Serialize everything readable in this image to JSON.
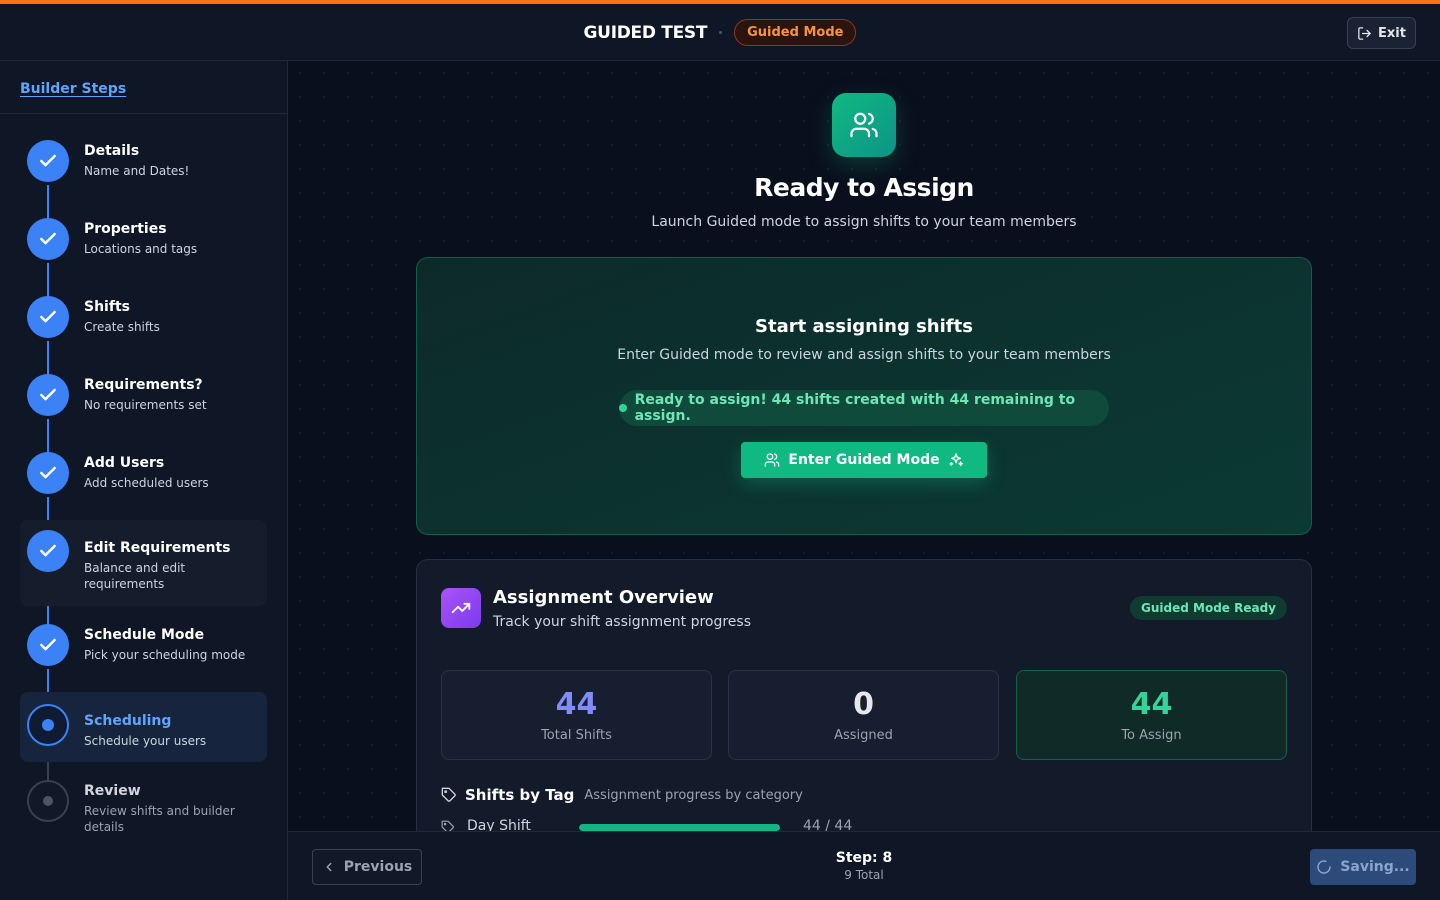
{
  "header": {
    "title": "GUIDED TEST",
    "mode_badge": "Guided Mode",
    "exit_label": "Exit"
  },
  "sidebar": {
    "title": "Builder Steps",
    "steps": [
      {
        "label": "Details",
        "sub": "Name and Dates!",
        "status": "done"
      },
      {
        "label": "Properties",
        "sub": "Locations and tags",
        "status": "done"
      },
      {
        "label": "Shifts",
        "sub": "Create shifts",
        "status": "done"
      },
      {
        "label": "Requirements?",
        "sub": "No requirements set",
        "status": "done"
      },
      {
        "label": "Add Users",
        "sub": "Add scheduled users",
        "status": "done"
      },
      {
        "label": "Edit Requirements",
        "sub": "Balance and edit requirements",
        "status": "done"
      },
      {
        "label": "Schedule Mode",
        "sub": "Pick your scheduling mode",
        "status": "done"
      },
      {
        "label": "Scheduling",
        "sub": "Schedule your users",
        "status": "current"
      },
      {
        "label": "Review",
        "sub": "Review shifts and builder details",
        "status": "todo"
      }
    ]
  },
  "hero": {
    "title": "Ready to Assign",
    "subtitle": "Launch Guided mode to assign shifts to your team members"
  },
  "start_card": {
    "title": "Start assigning shifts",
    "subtitle": "Enter Guided mode to review and assign shifts to your team members",
    "ready_text": "Ready to assign! 44 shifts created with 44 remaining to assign.",
    "button_label": "Enter Guided Mode"
  },
  "overview": {
    "title": "Assignment Overview",
    "subtitle": "Track your shift assignment progress",
    "badge": "Guided Mode Ready",
    "stats": [
      {
        "value": "44",
        "caption": "Total Shifts",
        "color": "#818cf8"
      },
      {
        "value": "0",
        "caption": "Assigned",
        "color": "#e5e7eb"
      },
      {
        "value": "44",
        "caption": "To Assign",
        "color": "#34d399"
      }
    ],
    "tags_title": "Shifts by Tag",
    "tags_subtitle": "Assignment progress by category",
    "tags": [
      {
        "name": "Day Shift",
        "count": "44 / 44",
        "progress": 1.0
      }
    ]
  },
  "footer": {
    "previous_label": "Previous",
    "step_label": "Step: 8",
    "total_label": "9 Total",
    "save_label": "Saving..."
  },
  "colors": {
    "accent_orange": "#f97316",
    "accent_blue": "#3b82f6",
    "accent_green": "#10b981",
    "accent_purple": "#a855f7"
  }
}
